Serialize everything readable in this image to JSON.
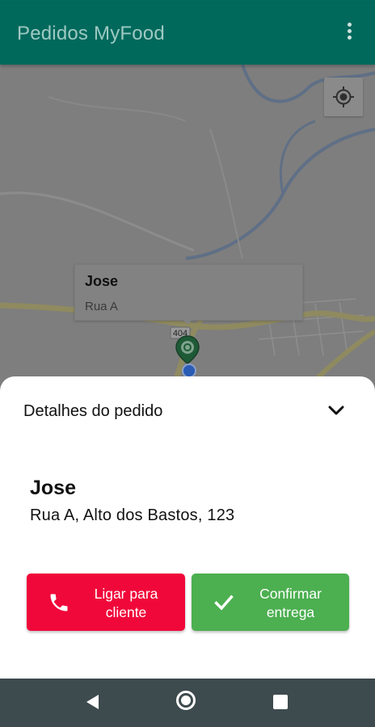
{
  "app": {
    "title": "Pedidos MyFood",
    "accent_color": "#00695c",
    "menu_icon": "more-vert-icon"
  },
  "map": {
    "locate_icon": "my-location-icon",
    "info_window": {
      "name": "Jose",
      "address": "Rua A"
    },
    "road_label": "404",
    "marker_icon": "map-pin-icon",
    "current_location_icon": "current-location-dot"
  },
  "order_sheet": {
    "title": "Detalhes do pedido",
    "collapse_icon": "chevron-down-icon",
    "customer_name": "Jose",
    "customer_address": "Rua A, Alto dos Bastos, 123",
    "call_button": {
      "label": "Ligar para\ncliente",
      "icon": "phone-icon",
      "color": "#f0083a"
    },
    "confirm_button": {
      "label": "Confirmar\nentrega",
      "icon": "check-icon",
      "color": "#4caf50"
    }
  },
  "navigation_bar": {
    "back_icon": "back-triangle-icon",
    "home_icon": "home-circle-icon",
    "recents_icon": "recents-square-icon"
  }
}
